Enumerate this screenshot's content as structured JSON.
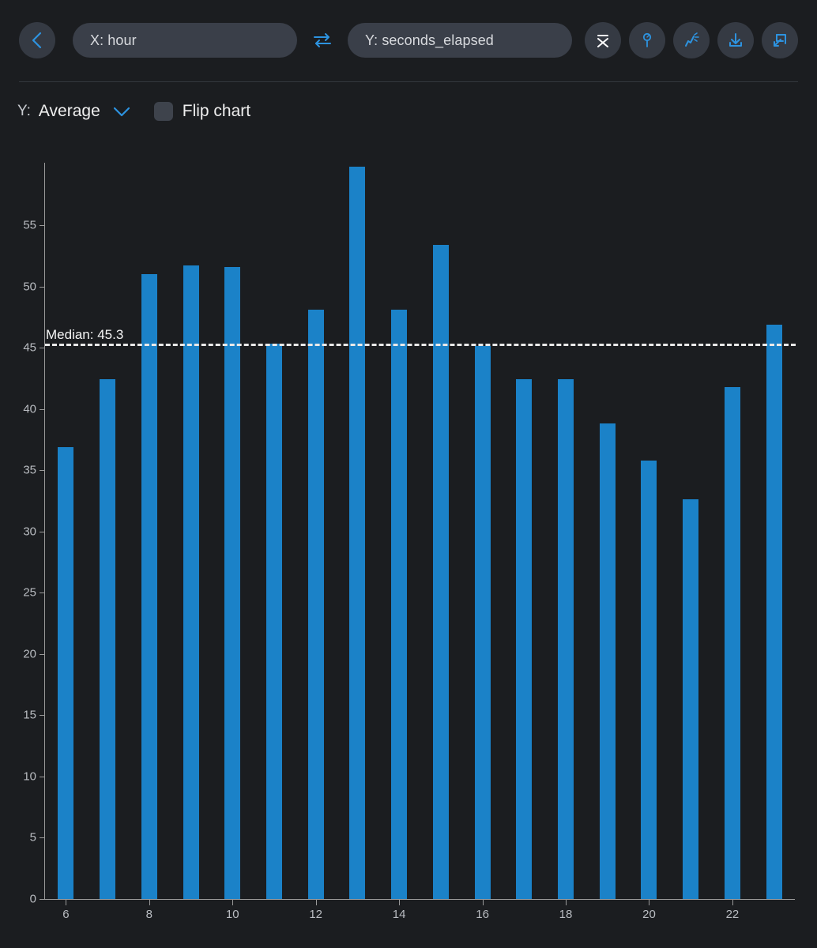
{
  "toolbar": {
    "back_icon": "chevron-left-icon",
    "x_field": "X: hour",
    "y_field": "Y: seconds_elapsed",
    "swap_icon": "swap-arrows-icon",
    "icons": [
      {
        "name": "mean-xbar-icon",
        "label": "x̄",
        "active": true
      },
      {
        "name": "pin-marker-icon",
        "label": "",
        "active": false
      },
      {
        "name": "magic-trend-icon",
        "label": "",
        "active": false
      },
      {
        "name": "download-icon",
        "label": "",
        "active": false
      },
      {
        "name": "expand-external-icon",
        "label": "",
        "active": false
      }
    ]
  },
  "controls": {
    "y_prefix": "Y:",
    "aggregate": "Average",
    "chevron_icon": "chevron-down-icon",
    "flip_chart_label": "Flip chart",
    "flip_chart_checked": false
  },
  "colors": {
    "background": "#1b1d20",
    "bar": "#1b82c8",
    "accent": "#2196e8",
    "axis": "#9a9a9a",
    "median": "#e9e9e9"
  },
  "chart_data": {
    "type": "bar",
    "title": "",
    "xlabel": "hour",
    "ylabel": "seconds_elapsed",
    "aggregate": "Average",
    "categories": [
      6,
      7,
      8,
      9,
      10,
      11,
      12,
      13,
      14,
      15,
      16,
      17,
      18,
      19,
      20,
      21,
      22,
      23
    ],
    "values": [
      36.9,
      42.4,
      51.0,
      51.7,
      51.6,
      45.3,
      48.1,
      59.8,
      48.1,
      53.4,
      45.1,
      42.4,
      42.4,
      38.8,
      35.8,
      32.6,
      41.8,
      46.9
    ],
    "ylim": [
      0,
      60
    ],
    "yticks": [
      0,
      5,
      10,
      15,
      20,
      25,
      30,
      35,
      40,
      45,
      50,
      55
    ],
    "xticks": [
      6,
      8,
      10,
      12,
      14,
      16,
      18,
      20,
      22
    ],
    "xlim": [
      5.5,
      23.5
    ],
    "grid": false,
    "legend": "none",
    "annotations": [
      {
        "type": "hline",
        "label": "Median: 45.3",
        "value": 45.3,
        "style": "dashed"
      }
    ]
  }
}
